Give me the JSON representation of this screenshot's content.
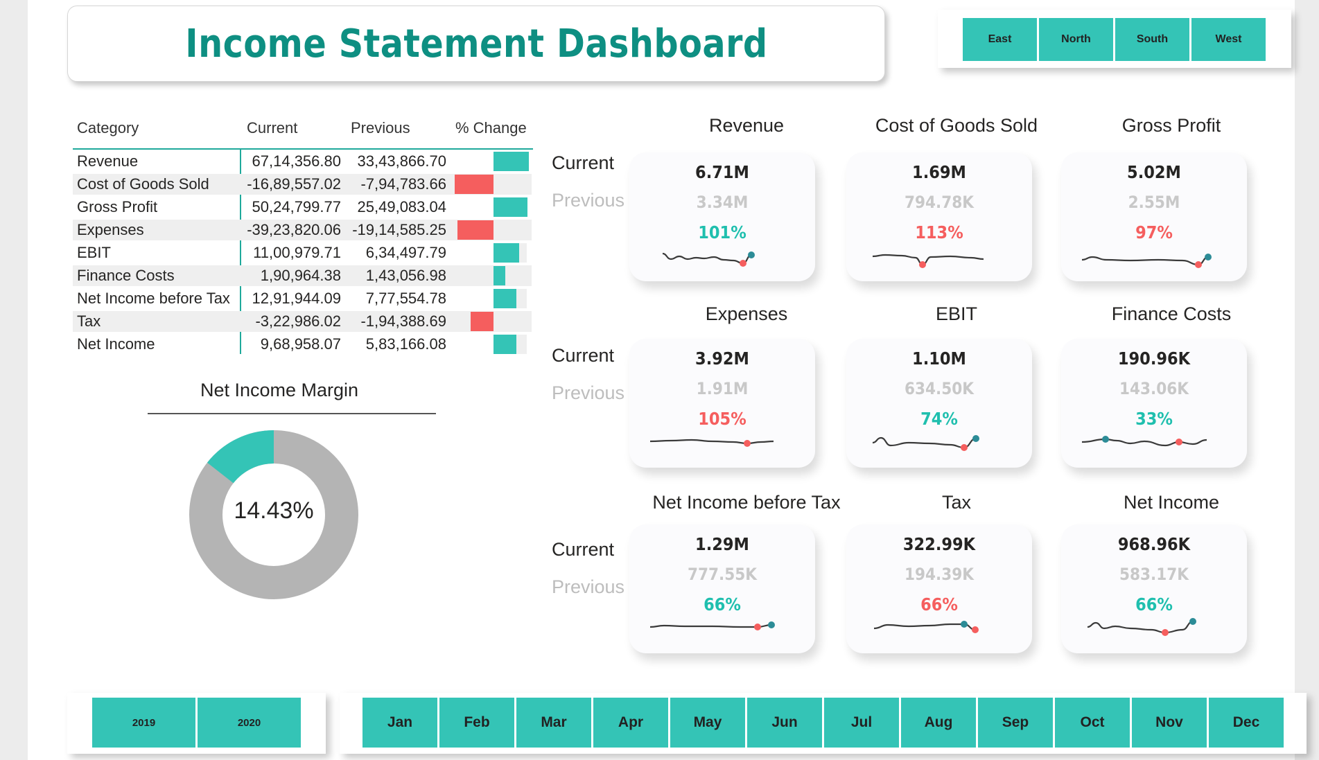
{
  "title": "Income Statement Dashboard",
  "regions": [
    "East",
    "North",
    "South",
    "West"
  ],
  "years": [
    "2019",
    "2020"
  ],
  "months": [
    "Jan",
    "Feb",
    "Mar",
    "Apr",
    "May",
    "Jun",
    "Jul",
    "Aug",
    "Sep",
    "Oct",
    "Nov",
    "Dec"
  ],
  "table": {
    "headers": [
      "Category",
      "Current",
      "Previous",
      "% Change"
    ],
    "rows": [
      {
        "category": "Revenue",
        "current": "67,14,356.80",
        "previous": "33,43,866.70",
        "pct": 1.01
      },
      {
        "category": "Cost of Goods Sold",
        "current": "-16,89,557.02",
        "previous": "-7,94,783.66",
        "pct": -1.13
      },
      {
        "category": "Gross Profit",
        "current": "50,24,799.77",
        "previous": "25,49,083.04",
        "pct": 0.97
      },
      {
        "category": "Expenses",
        "current": "-39,23,820.06",
        "previous": "-19,14,585.25",
        "pct": -1.05
      },
      {
        "category": "EBIT",
        "current": "11,00,979.71",
        "previous": "6,34,497.79",
        "pct": 0.74
      },
      {
        "category": "Finance Costs",
        "current": "1,90,964.38",
        "previous": "1,43,056.98",
        "pct": 0.33
      },
      {
        "category": "Net Income before Tax",
        "current": "12,91,944.09",
        "previous": "7,77,554.78",
        "pct": 0.66
      },
      {
        "category": "Tax",
        "current": "-3,22,986.02",
        "previous": "-1,94,388.69",
        "pct": -0.66
      },
      {
        "category": "Net Income",
        "current": "9,68,958.07",
        "previous": "5,83,166.08",
        "pct": 0.66
      }
    ]
  },
  "margin": {
    "title": "Net Income Margin",
    "value_label": "14.43%",
    "fraction": 0.1443
  },
  "kpi_row_labels": {
    "current": "Current",
    "previous": "Previous"
  },
  "kpis": [
    {
      "name": "Revenue",
      "current": "6.71M",
      "previous": "3.34M",
      "pct": "101%",
      "positive": true
    },
    {
      "name": "Cost of Goods Sold",
      "current": "1.69M",
      "previous": "794.78K",
      "pct": "113%",
      "positive": false
    },
    {
      "name": "Gross Profit",
      "current": "5.02M",
      "previous": "2.55M",
      "pct": "97%",
      "positive": false
    },
    {
      "name": "Expenses",
      "current": "3.92M",
      "previous": "1.91M",
      "pct": "105%",
      "positive": false
    },
    {
      "name": "EBIT",
      "current": "1.10M",
      "previous": "634.50K",
      "pct": "74%",
      "positive": true
    },
    {
      "name": "Finance Costs",
      "current": "190.96K",
      "previous": "143.06K",
      "pct": "33%",
      "positive": true
    },
    {
      "name": "Net Income before Tax",
      "current": "1.29M",
      "previous": "777.55K",
      "pct": "66%",
      "positive": true
    },
    {
      "name": "Tax",
      "current": "322.99K",
      "previous": "194.39K",
      "pct": "66%",
      "positive": false
    },
    {
      "name": "Net Income",
      "current": "968.96K",
      "previous": "583.17K",
      "pct": "66%",
      "positive": true
    }
  ],
  "colors": {
    "accent": "#34c4b6",
    "title": "#0e8f82",
    "positive": "#1fbfae",
    "negative": "#f55e5e",
    "muted": "#c8c8c8",
    "donut_rest": "#b4b4b4",
    "spark_line": "#3a3a3a"
  }
}
